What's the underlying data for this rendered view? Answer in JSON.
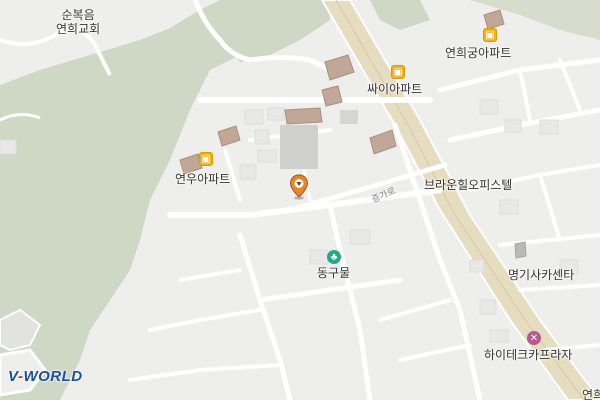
{
  "map": {
    "colors": {
      "background": "#eeeeec",
      "forest": "#cfd8c4",
      "highway": "#e6dcc0",
      "road": "#ffffff",
      "building": "#c0a797",
      "park": "#27a88a",
      "apartment": "#f2b21c"
    },
    "labels": {
      "church": "순복음\n연희교회",
      "yeonhee_gung_apt": "연희궁아파트",
      "ssai_apt": "싸이아파트",
      "yeonwoo_apt": "연우아파트",
      "brown_hill_officetel": "브라운힐오피스텔",
      "donggumul": "동구물",
      "myeonggi_car_center": "명기사카센타",
      "hitech_car_plaza": "하이테크카프라자",
      "road_junggi": "증가로",
      "edge_text": "연희"
    },
    "icons": {
      "apartment": "apartment-icon",
      "park": "park-icon",
      "shop": "tool-icon",
      "pin": "location-pin-icon"
    }
  },
  "branding": {
    "logo_prefix": "V",
    "logo_text": "WORLD"
  }
}
